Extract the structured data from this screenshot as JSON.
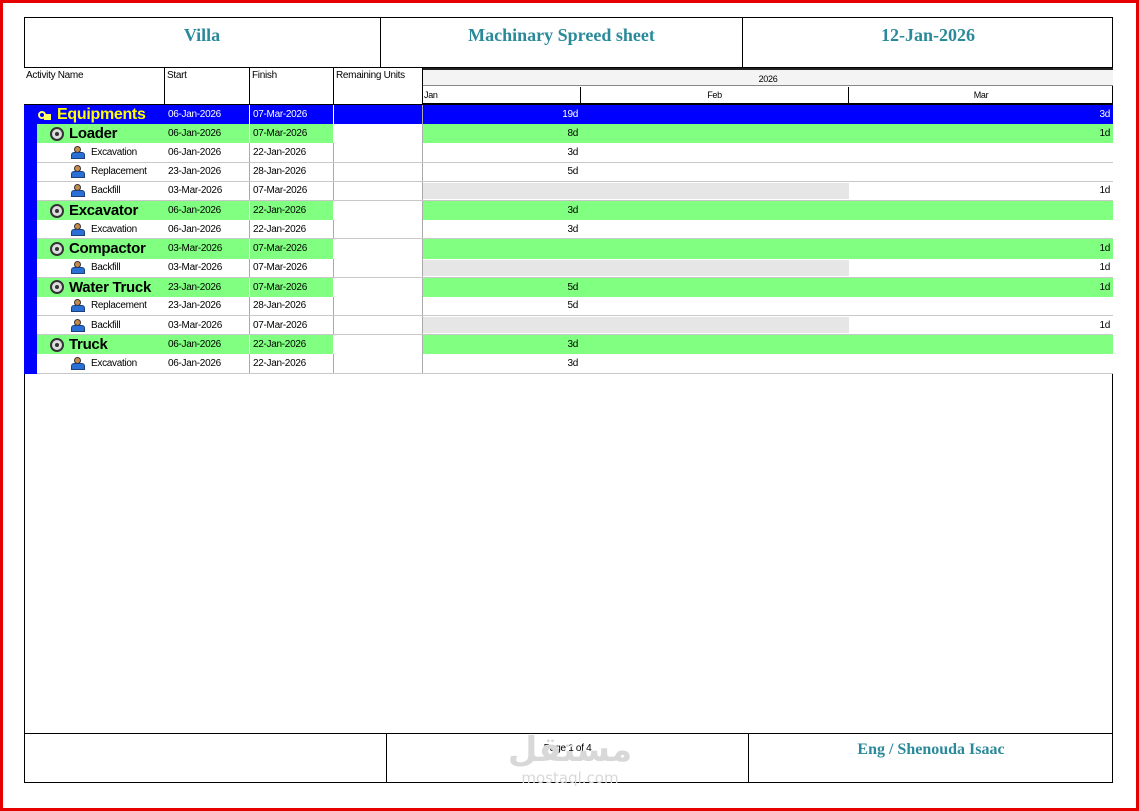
{
  "header": {
    "project": "Villa",
    "title": "Machinary Spreed sheet",
    "date": "12-Jan-2026"
  },
  "columns": {
    "activity_name": "Activity Name",
    "start": "Start",
    "finish": "Finish",
    "remaining_units": "Remaining Units"
  },
  "timescale": {
    "year": "2026",
    "months": [
      "Jan",
      "Feb",
      "Mar"
    ]
  },
  "rows": [
    {
      "type": "top",
      "icon": "equipment-icon",
      "name": "Equipments",
      "start": "06-Jan-2026",
      "finish": "07-Mar-2026",
      "jan": "19d",
      "mar": "3d"
    },
    {
      "type": "grp",
      "icon": "resource-group-icon",
      "name": "Loader",
      "start": "06-Jan-2026",
      "finish": "07-Mar-2026",
      "jan": "8d",
      "mar": "1d"
    },
    {
      "type": "act",
      "icon": "resource-icon",
      "name": "Excavation",
      "start": "06-Jan-2026",
      "finish": "22-Jan-2026",
      "jan": "3d",
      "mar": ""
    },
    {
      "type": "act",
      "icon": "resource-icon",
      "name": "Replacement",
      "start": "23-Jan-2026",
      "finish": "28-Jan-2026",
      "jan": "5d",
      "mar": ""
    },
    {
      "type": "act",
      "icon": "resource-icon",
      "name": "Backfill",
      "start": "03-Mar-2026",
      "finish": "07-Mar-2026",
      "jan": "",
      "mar": "1d",
      "gray": true
    },
    {
      "type": "grp",
      "icon": "resource-group-icon",
      "name": "Excavator",
      "start": "06-Jan-2026",
      "finish": "22-Jan-2026",
      "jan": "3d",
      "mar": ""
    },
    {
      "type": "act",
      "icon": "resource-icon",
      "name": "Excavation",
      "start": "06-Jan-2026",
      "finish": "22-Jan-2026",
      "jan": "3d",
      "mar": ""
    },
    {
      "type": "grp",
      "icon": "resource-group-icon",
      "name": "Compactor",
      "start": "03-Mar-2026",
      "finish": "07-Mar-2026",
      "jan": "",
      "mar": "1d"
    },
    {
      "type": "act",
      "icon": "resource-icon",
      "name": "Backfill",
      "start": "03-Mar-2026",
      "finish": "07-Mar-2026",
      "jan": "",
      "mar": "1d",
      "gray": true
    },
    {
      "type": "grp",
      "icon": "resource-group-icon",
      "name": "Water Truck",
      "start": "23-Jan-2026",
      "finish": "07-Mar-2026",
      "jan": "5d",
      "mar": "1d"
    },
    {
      "type": "act",
      "icon": "resource-icon",
      "name": "Replacement",
      "start": "23-Jan-2026",
      "finish": "28-Jan-2026",
      "jan": "5d",
      "mar": ""
    },
    {
      "type": "act",
      "icon": "resource-icon",
      "name": "Backfill",
      "start": "03-Mar-2026",
      "finish": "07-Mar-2026",
      "jan": "",
      "mar": "1d",
      "gray": true
    },
    {
      "type": "grp",
      "icon": "resource-group-icon",
      "name": "Truck",
      "start": "06-Jan-2026",
      "finish": "22-Jan-2026",
      "jan": "3d",
      "mar": ""
    },
    {
      "type": "act",
      "icon": "resource-icon",
      "name": "Excavation",
      "start": "06-Jan-2026",
      "finish": "22-Jan-2026",
      "jan": "3d",
      "mar": ""
    }
  ],
  "footer": {
    "page": "Page 1 of 4",
    "author": "Eng / Shenouda Isaac"
  },
  "watermark": {
    "arabic": "مستقل",
    "latin": "mostaql.com"
  },
  "colors": {
    "border": "#e60000",
    "title": "#2b8a9a",
    "top_row": "#0000ff",
    "group_row": "#80ff80"
  }
}
